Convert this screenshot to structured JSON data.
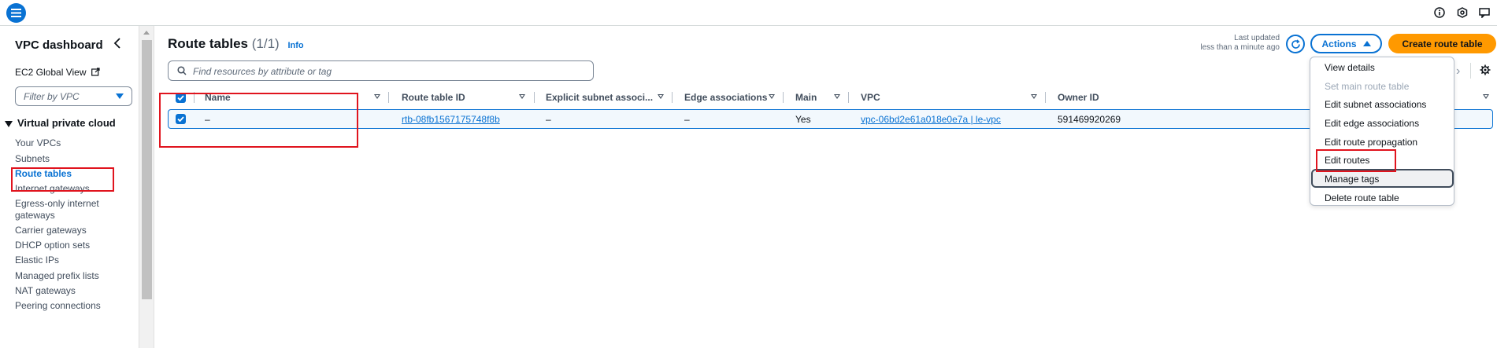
{
  "topbar": {
    "menu_icon": "hamburger-icon",
    "icons": [
      "info-icon",
      "settings-hex-icon",
      "feedback-icon"
    ]
  },
  "sidebar": {
    "title": "VPC dashboard",
    "ec2_global_view": "EC2 Global View",
    "filter_placeholder": "Filter by VPC",
    "section": "Virtual private cloud",
    "items": [
      {
        "label": "Your VPCs"
      },
      {
        "label": "Subnets"
      },
      {
        "label": "Route tables",
        "active": true
      },
      {
        "label": "Internet gateways"
      },
      {
        "label": "Egress-only internet"
      },
      {
        "label": "gateways"
      },
      {
        "label": "Carrier gateways"
      },
      {
        "label": "DHCP option sets"
      },
      {
        "label": "Elastic IPs"
      },
      {
        "label": "Managed prefix lists"
      },
      {
        "label": "NAT gateways"
      },
      {
        "label": "Peering connections"
      }
    ]
  },
  "header": {
    "title": "Route tables",
    "count": "(1/1)",
    "info": "Info",
    "last_updated_line1": "Last updated",
    "last_updated_line2": "less than a minute ago",
    "actions_label": "Actions",
    "create_label": "Create route table"
  },
  "search": {
    "placeholder": "Find resources by attribute or tag"
  },
  "table": {
    "columns": [
      "Name",
      "Route table ID",
      "Explicit subnet associ...",
      "Edge associations",
      "Main",
      "VPC",
      "Owner ID"
    ],
    "rows": [
      {
        "selected": true,
        "name": "–",
        "route_table_id": "rtb-08fb1567175748f8b",
        "explicit_subnet": "–",
        "edge_associations": "–",
        "main": "Yes",
        "vpc": "vpc-06bd2e61a018e0e7a | le-vpc",
        "owner_id": "591469920269"
      }
    ]
  },
  "actions_menu": {
    "items": [
      {
        "label": "View details",
        "disabled": false
      },
      {
        "label": "Set main route table",
        "disabled": true
      },
      {
        "label": "Edit subnet associations",
        "disabled": false
      },
      {
        "label": "Edit edge associations",
        "disabled": false
      },
      {
        "label": "Edit route propagation",
        "disabled": false
      },
      {
        "label": "Edit routes",
        "disabled": false
      },
      {
        "label": "Manage tags",
        "disabled": false
      },
      {
        "label": "Delete route table",
        "disabled": false
      }
    ]
  },
  "colors": {
    "accent": "#0972d3",
    "primary_button": "#ff9900",
    "annotation": "#e0141e"
  }
}
